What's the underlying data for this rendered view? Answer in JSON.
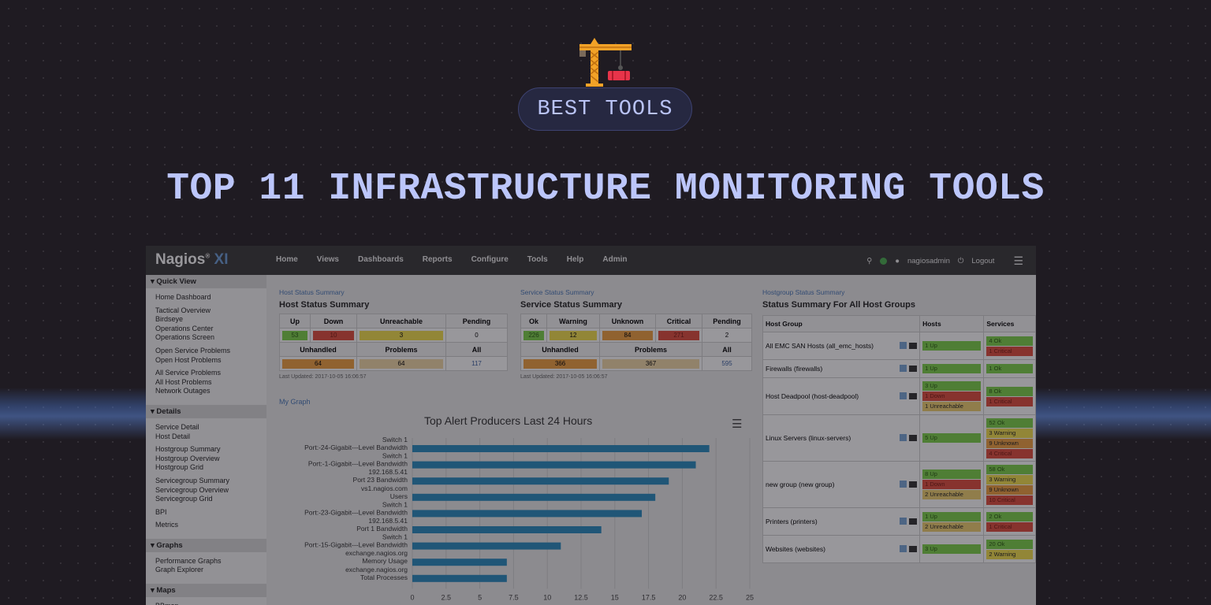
{
  "badge": {
    "label": "BEST TOOLS",
    "icon": "crane-icon"
  },
  "headline": "TOP 11 INFRASTRUCTURE MONITORING TOOLS",
  "app": {
    "logo_main": "Nagios",
    "logo_suffix": "XI",
    "nav": [
      "Home",
      "Views",
      "Dashboards",
      "Reports",
      "Configure",
      "Tools",
      "Help",
      "Admin"
    ],
    "user": "nagiosadmin",
    "logout": "Logout"
  },
  "sidebar": {
    "sections": [
      {
        "title": "Quick View",
        "groups": [
          [
            "Home Dashboard"
          ],
          [
            "Tactical Overview",
            "Birdseye",
            "Operations Center",
            "Operations Screen"
          ],
          [
            "Open Service Problems",
            "Open Host Problems"
          ],
          [
            "All Service Problems",
            "All Host Problems",
            "Network Outages"
          ]
        ]
      },
      {
        "title": "Details",
        "groups": [
          [
            "Service Detail",
            "Host Detail"
          ],
          [
            "Hostgroup Summary",
            "Hostgroup Overview",
            "Hostgroup Grid"
          ],
          [
            "Servicegroup Summary",
            "Servicegroup Overview",
            "Servicegroup Grid"
          ],
          [
            "BPI"
          ],
          [
            "Metrics"
          ]
        ]
      },
      {
        "title": "Graphs",
        "groups": [
          [
            "Performance Graphs",
            "Graph Explorer"
          ]
        ]
      },
      {
        "title": "Maps",
        "groups": [
          [
            "BBmap"
          ]
        ]
      }
    ]
  },
  "host_summary": {
    "link": "Host Status Summary",
    "title": "Host Status Summary",
    "headers": [
      "Up",
      "Down",
      "Unreachable",
      "Pending"
    ],
    "values": [
      "53",
      "10",
      "3",
      "0"
    ],
    "headers2": [
      "Unhandled",
      "Problems",
      "All"
    ],
    "values2": [
      "64",
      "64",
      "117"
    ],
    "updated": "Last Updated: 2017-10-05 16:06:57"
  },
  "service_summary": {
    "link": "Service Status Summary",
    "title": "Service Status Summary",
    "headers": [
      "Ok",
      "Warning",
      "Unknown",
      "Critical",
      "Pending"
    ],
    "values": [
      "226",
      "12",
      "84",
      "271",
      "2"
    ],
    "headers2": [
      "Unhandled",
      "Problems",
      "All"
    ],
    "values2": [
      "366",
      "367",
      "595"
    ],
    "updated": "Last Updated: 2017-10-05 16:06:57"
  },
  "hostgroup_summary": {
    "link": "Hostgroup Status Summary",
    "title": "Status Summary For All Host Groups",
    "headers": [
      "Host Group",
      "Hosts",
      "Services"
    ],
    "rows": [
      {
        "name": "All EMC SAN Hosts (all_emc_hosts)",
        "hosts": [
          [
            "1 Up",
            "up"
          ]
        ],
        "services": [
          [
            "4 Ok",
            "up"
          ],
          [
            "1 Critical",
            "crit"
          ]
        ]
      },
      {
        "name": "Firewalls (firewalls)",
        "hosts": [
          [
            "1 Up",
            "up"
          ]
        ],
        "services": [
          [
            "1 Ok",
            "up"
          ]
        ]
      },
      {
        "name": "Host Deadpool (host-deadpool)",
        "hosts": [
          [
            "3 Up",
            "up"
          ],
          [
            "1 Down",
            "crit"
          ],
          [
            "1 Unreachable",
            "unr"
          ]
        ],
        "services": [
          [
            "8 Ok",
            "up"
          ],
          [
            "1 Critical",
            "crit"
          ]
        ]
      },
      {
        "name": "Linux Servers (linux-servers)",
        "hosts": [
          [
            "5 Up",
            "up"
          ]
        ],
        "services": [
          [
            "52 Ok",
            "up"
          ],
          [
            "3 Warning",
            "warn"
          ],
          [
            "9 Unknown",
            "unk"
          ],
          [
            "4 Critical",
            "crit"
          ]
        ]
      },
      {
        "name": "new group (new group)",
        "hosts": [
          [
            "8 Up",
            "up"
          ],
          [
            "1 Down",
            "crit"
          ],
          [
            "2 Unreachable",
            "unr"
          ]
        ],
        "services": [
          [
            "58 Ok",
            "up"
          ],
          [
            "3 Warning",
            "warn"
          ],
          [
            "9 Unknown",
            "unk"
          ],
          [
            "10 Critical",
            "crit"
          ]
        ]
      },
      {
        "name": "Printers (printers)",
        "hosts": [
          [
            "1 Up",
            "up"
          ],
          [
            "2 Unreachable",
            "unr"
          ]
        ],
        "services": [
          [
            "2 Ok",
            "up"
          ],
          [
            "1 Critical",
            "crit"
          ]
        ]
      },
      {
        "name": "Websites (websites)",
        "hosts": [
          [
            "3 Up",
            "up"
          ]
        ],
        "services": [
          [
            "20 Ok",
            "up"
          ],
          [
            "2 Warning",
            "warn"
          ]
        ]
      }
    ]
  },
  "graph": {
    "link": "My Graph"
  },
  "chart_data": {
    "type": "bar",
    "orientation": "horizontal",
    "title": "Top Alert Producers Last 24 Hours",
    "categories": [
      [
        "Switch 1",
        "Port:-24-Gigabit---Level Bandwidth"
      ],
      [
        "Switch 1",
        "Port:-1-Gigabit---Level Bandwidth"
      ],
      [
        "192.168.5.41",
        "Port 23 Bandwidth"
      ],
      [
        "vs1.nagios.com",
        "Users"
      ],
      [
        "Switch 1",
        "Port:-23-Gigabit---Level Bandwidth"
      ],
      [
        "192.168.5.41",
        "Port 1 Bandwidth"
      ],
      [
        "Switch 1",
        "Port:-15-Gigabit---Level Bandwidth"
      ],
      [
        "exchange.nagios.org",
        "Memory Usage"
      ],
      [
        "exchange.nagios.org",
        "Total Processes"
      ]
    ],
    "values": [
      22,
      21,
      19,
      18,
      17,
      14,
      11,
      7,
      7
    ],
    "xlim": [
      0,
      25
    ],
    "xticks": [
      "0",
      "2.5",
      "5",
      "7.5",
      "10",
      "12.5",
      "15",
      "17.5",
      "20",
      "22.5",
      "25"
    ],
    "bar_color": "#2a8cbf",
    "grid": true
  }
}
